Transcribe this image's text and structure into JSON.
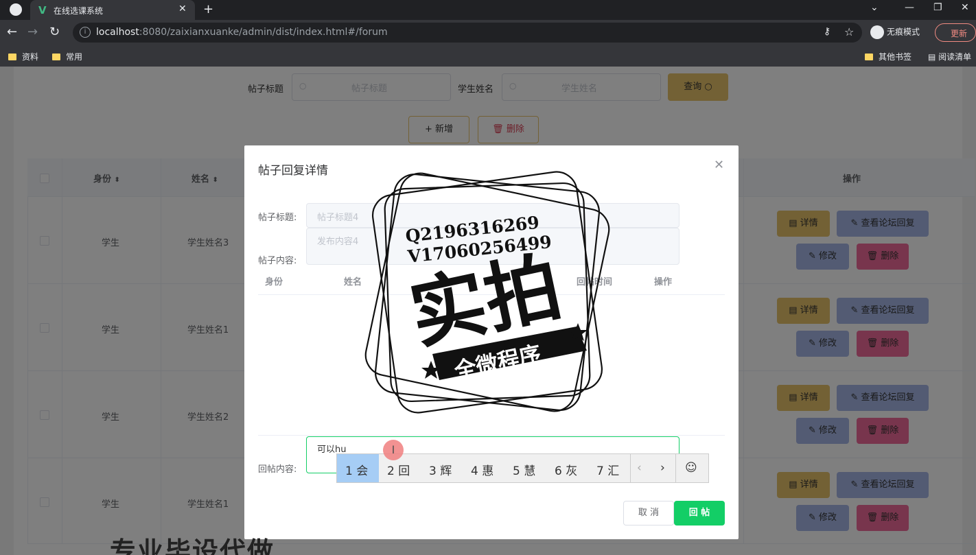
{
  "browser": {
    "tab_title": "在线选课系统",
    "url_host": "localhost",
    "url_rest": ":8080/zaixianxuanke/admin/dist/index.html#/forum",
    "incognito_label": "无痕模式",
    "update_label": "更新",
    "bookmarks": [
      "资料",
      "常用"
    ],
    "bookmarks_right": [
      "其他书签",
      "阅读清单"
    ]
  },
  "search": {
    "title_label": "帖子标题",
    "title_placeholder": "帖子标题",
    "student_label": "学生姓名",
    "student_placeholder": "学生姓名",
    "query_button": "查询"
  },
  "actions": {
    "add_button": "新增",
    "delete_button": "删除"
  },
  "table": {
    "headers": [
      "身份",
      "姓名",
      "操作"
    ],
    "rows": [
      {
        "identity": "学生",
        "name": "学生姓名3"
      },
      {
        "identity": "学生",
        "name": "学生姓名1"
      },
      {
        "identity": "学生",
        "name": "学生姓名2"
      },
      {
        "identity": "学生",
        "name": "学生姓名1"
      }
    ],
    "row_buttons": {
      "detail": "详情",
      "view_reply": "查看论坛回复",
      "edit": "修改",
      "delete": "删除"
    }
  },
  "dialog": {
    "title": "帖子回复详情",
    "post_title_label": "帖子标题:",
    "post_title_value": "帖子标题4",
    "post_content_label": "帖子内容:",
    "post_content_value": "发布内容4",
    "sub_headers": [
      "身份",
      "姓名",
      "回帖时间",
      "操作"
    ],
    "reply_label": "回帖内容:",
    "reply_value": "可以hu",
    "cancel_button": "取 消",
    "submit_button": "回 帖"
  },
  "ime": {
    "candidates": [
      "1 会",
      "2 回",
      "3 辉",
      "4 惠",
      "5 慧",
      "6 灰",
      "7 汇"
    ]
  },
  "watermark": {
    "line1": "Q2196316269",
    "line2": "V17060256499",
    "big": "实拍",
    "banner": "全微程序"
  },
  "overlay_caption": "专业毕设代做",
  "colors": {
    "primary_yellow": "#e6c26a",
    "blue": "#a6b7e6",
    "pink": "#f06a9a",
    "green": "#13ce66"
  }
}
